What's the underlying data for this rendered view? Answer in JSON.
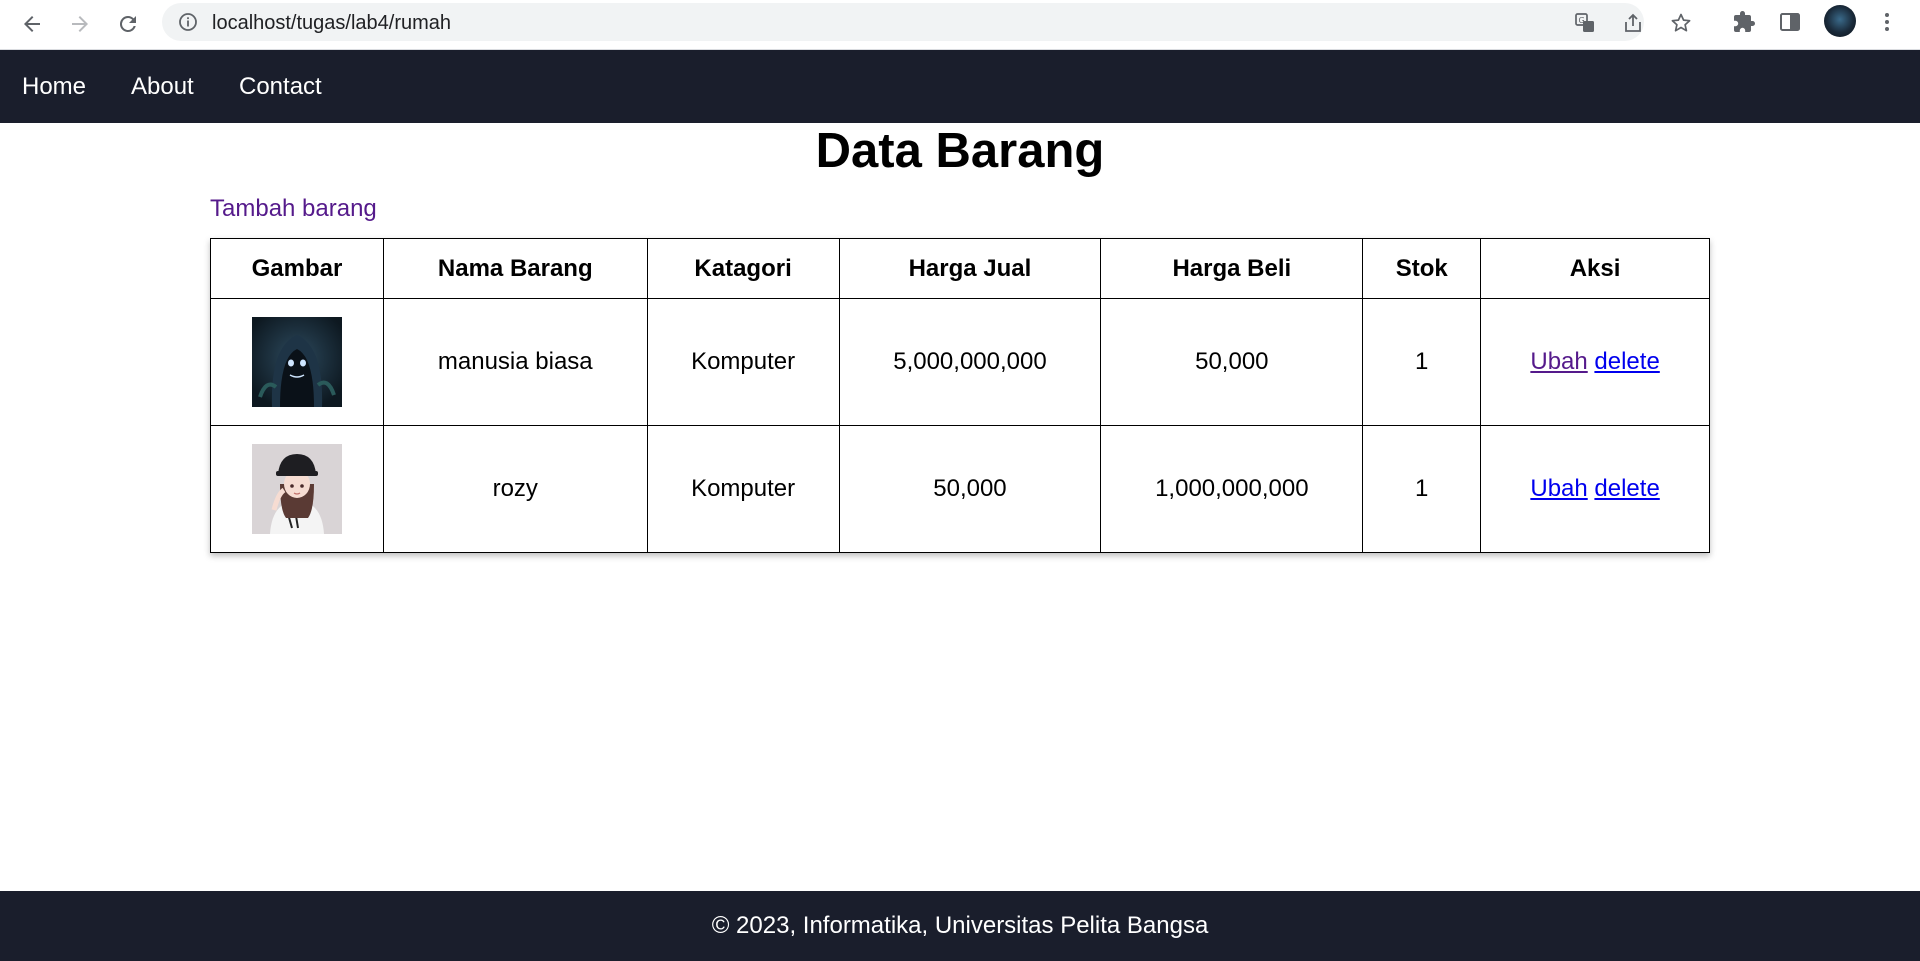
{
  "browser": {
    "url": "localhost/tugas/lab4/rumah"
  },
  "nav": {
    "items": [
      {
        "label": "Home"
      },
      {
        "label": "About"
      },
      {
        "label": "Contact"
      }
    ]
  },
  "page": {
    "title": "Data Barang",
    "add_link": "Tambah barang"
  },
  "table": {
    "headers": [
      "Gambar",
      "Nama Barang",
      "Katagori",
      "Harga Jual",
      "Harga Beli",
      "Stok",
      "Aksi"
    ],
    "rows": [
      {
        "image_icon": "hooded-creature-image",
        "nama": "manusia biasa",
        "kategori": "Komputer",
        "harga_jual": "5,000,000,000",
        "harga_beli": "50,000",
        "stok": "1",
        "ubah": "Ubah",
        "delete": "delete"
      },
      {
        "image_icon": "anime-girl-cap-image",
        "nama": "rozy",
        "kategori": "Komputer",
        "harga_jual": "50,000",
        "harga_beli": "1,000,000,000",
        "stok": "1",
        "ubah": "Ubah",
        "delete": "delete"
      }
    ]
  },
  "footer": {
    "text": "© 2023, Informatika, Universitas Pelita Bangsa"
  },
  "colors": {
    "nav_bg": "#1a1e2c",
    "link": "#0000ee",
    "visited_link": "#551a8b"
  }
}
